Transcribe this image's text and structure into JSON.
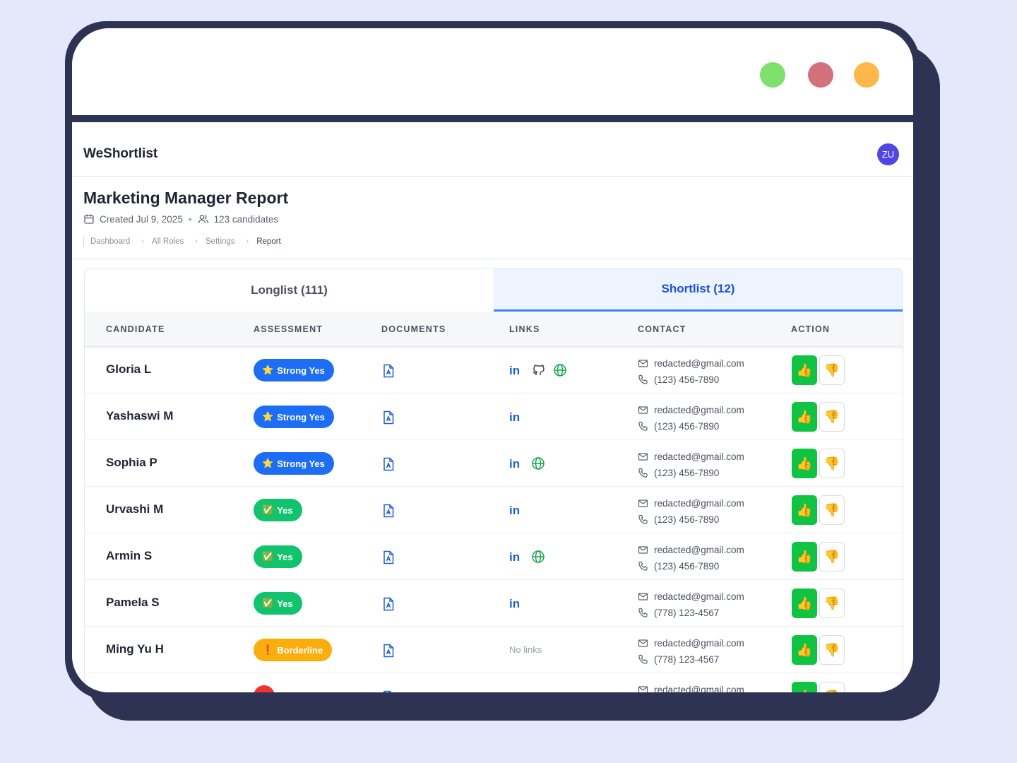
{
  "window": {
    "controls": [
      {
        "name": "green-window-button",
        "color": "#7fe06b"
      },
      {
        "name": "red-window-button",
        "color": "#d2707c"
      },
      {
        "name": "yellow-window-button",
        "color": "#fdb847"
      }
    ]
  },
  "app": {
    "brand": "WeShortlist",
    "user_initials": "ZU"
  },
  "report": {
    "title": "Marketing Manager Report",
    "created": "Created Jul 9, 2025",
    "separator": "•",
    "candidate_count": "123 candidates"
  },
  "breadcrumb": [
    "Dashboard",
    "All Roles",
    "Settings",
    "Report"
  ],
  "tabs": [
    {
      "label": "Longlist (111)",
      "active": false
    },
    {
      "label": "Shortlist (12)",
      "active": true
    }
  ],
  "columns": [
    "CANDIDATE",
    "ASSESSMENT",
    "DOCUMENTS",
    "LINKS",
    "CONTACT",
    "ACTION"
  ],
  "rows": [
    {
      "name": "Gloria L",
      "assessment": "Strong Yes",
      "emoji": "⭐",
      "level": "strong",
      "links": [
        "linkedin-icon",
        "github-icon",
        "globe-icon"
      ],
      "email": "redacted@gmail.com",
      "phone": "(123) 456-7890"
    },
    {
      "name": "Yashaswi M",
      "assessment": "Strong Yes",
      "emoji": "⭐",
      "level": "strong",
      "links": [
        "linkedin-icon"
      ],
      "email": "redacted@gmail.com",
      "phone": "(123) 456-7890"
    },
    {
      "name": "Sophia P",
      "assessment": "Strong Yes",
      "emoji": "⭐",
      "level": "strong",
      "links": [
        "linkedin-icon",
        "globe-icon"
      ],
      "email": "redacted@gmail.com",
      "phone": "(123) 456-7890"
    },
    {
      "name": "Urvashi M",
      "assessment": "Yes",
      "emoji": "✅",
      "level": "yes",
      "links": [
        "linkedin-icon"
      ],
      "email": "redacted@gmail.com",
      "phone": "(123) 456-7890"
    },
    {
      "name": "Armin S",
      "assessment": "Yes",
      "emoji": "✅",
      "level": "yes",
      "links": [
        "linkedin-icon",
        "globe-icon"
      ],
      "email": "redacted@gmail.com",
      "phone": "(123) 456-7890"
    },
    {
      "name": "Pamela S",
      "assessment": "Yes",
      "emoji": "✅",
      "level": "yes",
      "links": [
        "linkedin-icon"
      ],
      "email": "redacted@gmail.com",
      "phone": "(778) 123-4567"
    },
    {
      "name": "Ming Yu H",
      "assessment": "Borderline",
      "emoji": "❗",
      "level": "border",
      "links": [],
      "no_links_text": "No links",
      "email": "redacted@gmail.com",
      "phone": "(778) 123-4567"
    },
    {
      "name": "",
      "assessment": "",
      "emoji": "",
      "level": "no",
      "links": [],
      "email": "redacted@gmail.com",
      "phone": ""
    }
  ],
  "actions": {
    "approve_emoji": "👍",
    "reject_emoji": "👎"
  },
  "colors": {
    "background": "#e3e8fb",
    "frame": "#2e3353",
    "strong_yes": "#1d6ef5",
    "yes": "#10c36c",
    "borderline": "#fbad0c",
    "no": "#ef3333",
    "approve": "#10c342",
    "active_tab": "#1d4ed8",
    "avatar": "#4f46e5"
  }
}
